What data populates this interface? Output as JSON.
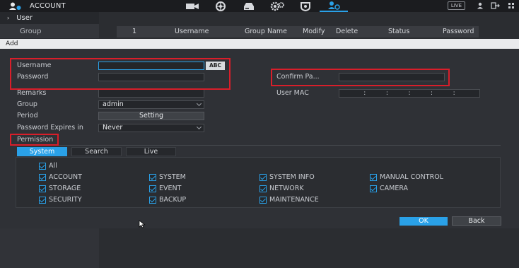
{
  "header": {
    "title": "ACCOUNT",
    "nav_icons": [
      "camera-icon",
      "network-icon",
      "storage-icon",
      "settings-icon",
      "security-icon",
      "account-icon"
    ],
    "live_label": "LIVE"
  },
  "sidebar": {
    "user_label": "User",
    "group_label": "Group"
  },
  "table": {
    "columns": [
      "1",
      "Username",
      "Group Name",
      "Modify",
      "Delete",
      "Status",
      "Password"
    ]
  },
  "dialog": {
    "title": "Add",
    "username_label": "Username",
    "username_value": "",
    "abc_label": "ABC",
    "password_label": "Password",
    "confirm_label": "Confirm Pa...",
    "remarks_label": "Remarks",
    "user_mac_label": "User MAC",
    "group_label": "Group",
    "group_value": "admin",
    "period_label": "Period",
    "setting_label": "Setting",
    "expires_label": "Password Expires in",
    "expires_value": "Never",
    "permission_label": "Permission",
    "tabs": [
      "System",
      "Search",
      "Live"
    ],
    "permissions": {
      "all": "All",
      "items": [
        "ACCOUNT",
        "SYSTEM",
        "SYSTEM INFO",
        "MANUAL CONTROL",
        "STORAGE",
        "EVENT",
        "NETWORK",
        "CAMERA",
        "SECURITY",
        "BACKUP",
        "MAINTENANCE"
      ]
    },
    "ok_label": "OK",
    "back_label": "Back"
  },
  "colors": {
    "accent": "#2aa1e8",
    "highlight_box": "#d91e2a"
  }
}
